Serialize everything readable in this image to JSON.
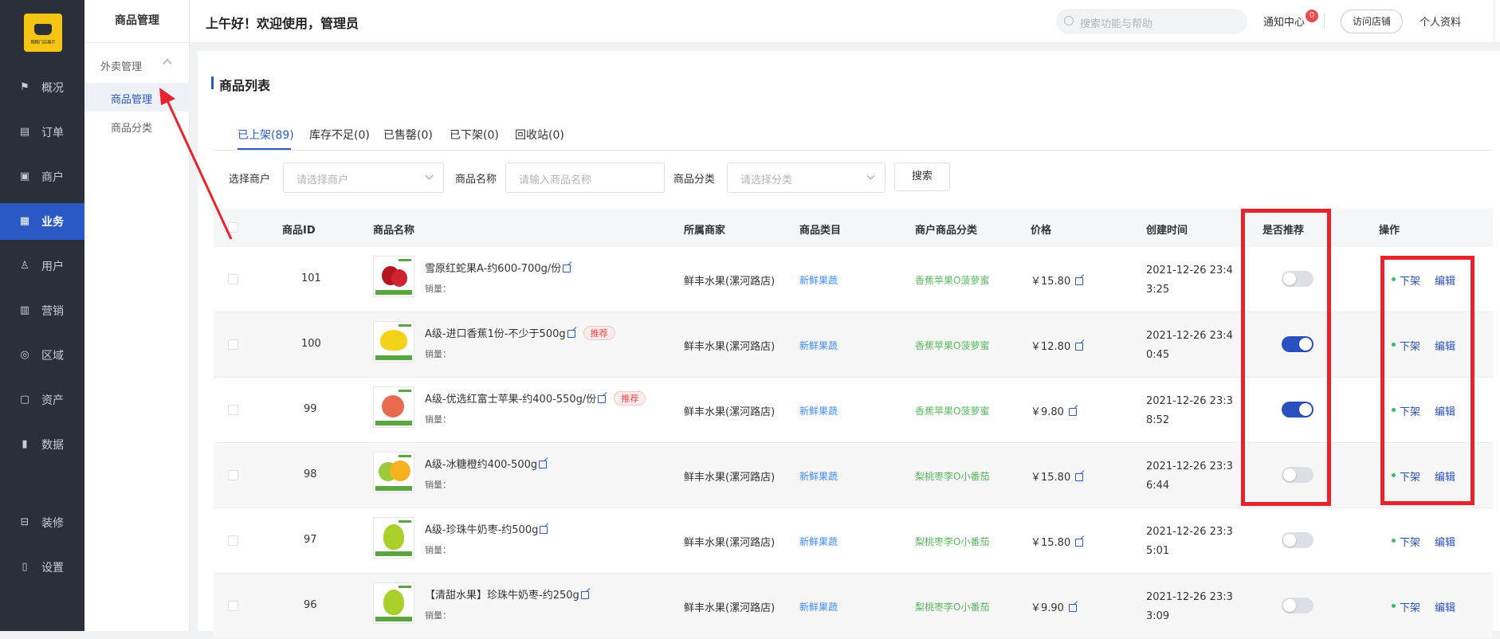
{
  "nav": {
    "logo_text": "糯糯门店展示",
    "items": [
      {
        "label": "概况",
        "icon": "dashboard-icon"
      },
      {
        "label": "订单",
        "icon": "order-icon"
      },
      {
        "label": "商户",
        "icon": "merchant-icon"
      },
      {
        "label": "业务",
        "icon": "business-icon",
        "active": true
      },
      {
        "label": "用户",
        "icon": "user-icon"
      },
      {
        "label": "营销",
        "icon": "marketing-icon"
      },
      {
        "label": "区域",
        "icon": "region-icon"
      },
      {
        "label": "资产",
        "icon": "assets-icon"
      },
      {
        "label": "数据",
        "icon": "data-icon"
      },
      {
        "label": "装修",
        "icon": "decorate-icon"
      },
      {
        "label": "设置",
        "icon": "settings-icon"
      }
    ]
  },
  "subnav": {
    "title": "商品管理",
    "group": "外卖管理",
    "item_active": "商品管理",
    "item2": "商品分类"
  },
  "header": {
    "greeting": "上午好！欢迎使用，管理员",
    "search_placeholder": "搜索功能与帮助",
    "notice": "通知中心",
    "notice_count": "0",
    "visit_store": "访问店铺",
    "profile": "个人资料"
  },
  "card": {
    "title": "商品列表",
    "tabs": [
      "已上架(89)",
      "库存不足(0)",
      "已售罄(0)",
      "已下架(0)",
      "回收站(0)"
    ],
    "filters": {
      "merchant_label": "选择商户",
      "merchant_placeholder": "请选择商户",
      "name_label": "商品名称",
      "name_placeholder": "请输入商品名称",
      "category_label": "商品分类",
      "category_placeholder": "请选择分类",
      "search_button": "搜索"
    },
    "columns": [
      "商品ID",
      "商品名称",
      "所属商家",
      "商品类目",
      "商户商品分类",
      "价格",
      "创建时间",
      "是否推荐",
      "操作"
    ],
    "sales_label": "销量：",
    "recommend_tag": "推荐",
    "op_offshelf": "下架",
    "op_edit": "编辑",
    "rows": [
      {
        "id": "101",
        "name": "雪原红蛇果A-约600-700g/份",
        "recommended_tag": false,
        "merchant": "鲜丰水果(漯河路店)",
        "category": "新鲜果蔬",
        "mcat": "香蕉苹果O菠萝蜜",
        "price": "￥15.80",
        "time": "2021-12-26 23:43:25",
        "recommend": false
      },
      {
        "id": "100",
        "name": "A级-进口香蕉1份-不少于500g",
        "recommended_tag": true,
        "merchant": "鲜丰水果(漯河路店)",
        "category": "新鲜果蔬",
        "mcat": "香蕉苹果O菠萝蜜",
        "price": "￥12.80",
        "time": "2021-12-26 23:40:45",
        "recommend": true
      },
      {
        "id": "99",
        "name": "A级-优选红富士苹果-约400-550g/份",
        "recommended_tag": true,
        "merchant": "鲜丰水果(漯河路店)",
        "category": "新鲜果蔬",
        "mcat": "香蕉苹果O菠萝蜜",
        "price": "￥9.80",
        "time": "2021-12-26 23:38:52",
        "recommend": true
      },
      {
        "id": "98",
        "name": "A级-冰糖橙约400-500g",
        "recommended_tag": false,
        "merchant": "鲜丰水果(漯河路店)",
        "category": "新鲜果蔬",
        "mcat": "梨桃枣李O小番茄",
        "price": "￥15.80",
        "time": "2021-12-26 23:36:44",
        "recommend": false
      },
      {
        "id": "97",
        "name": "A级-珍珠牛奶枣-约500g",
        "recommended_tag": false,
        "merchant": "鲜丰水果(漯河路店)",
        "category": "新鲜果蔬",
        "mcat": "梨桃枣李O小番茄",
        "price": "￥15.80",
        "time": "2021-12-26 23:35:01",
        "recommend": false
      },
      {
        "id": "96",
        "name": "【清甜水果】珍珠牛奶枣-约250g",
        "recommended_tag": false,
        "merchant": "鲜丰水果(漯河路店)",
        "category": "新鲜果蔬",
        "mcat": "梨桃枣李O小番茄",
        "price": "￥9.90",
        "time": "2021-12-26 23:33:09",
        "recommend": false
      }
    ]
  },
  "colors": {
    "accent": "#2a58c5",
    "nav_bg": "#2b2f3a",
    "annotation_red": "#e8232c",
    "category_blue": "#3d8bff",
    "mcat_green": "#59b85c"
  }
}
